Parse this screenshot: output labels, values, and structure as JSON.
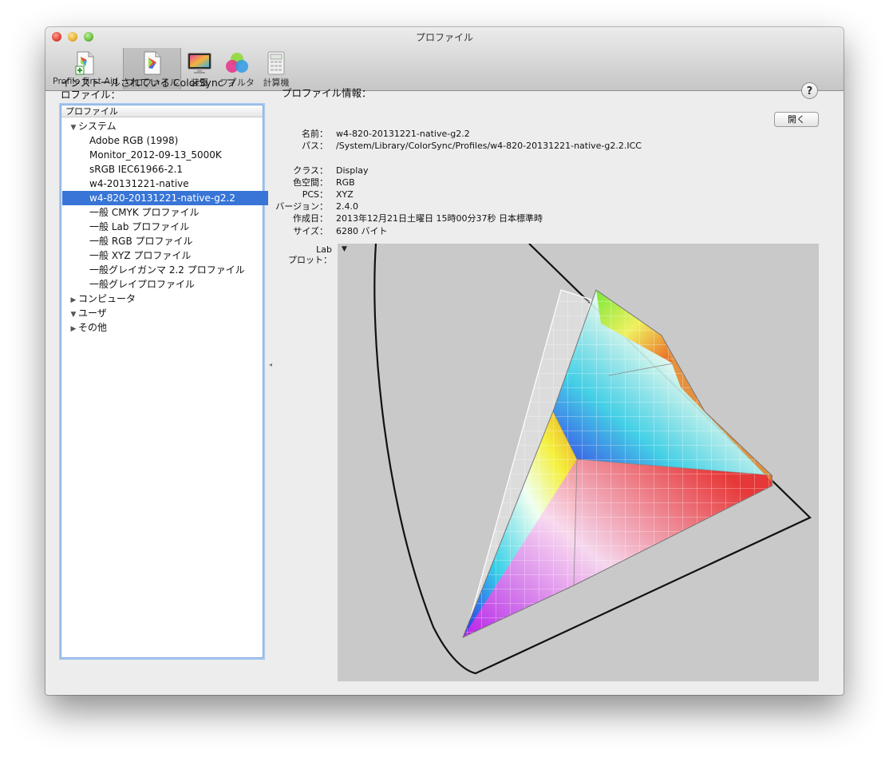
{
  "window": {
    "title": "プロファイル"
  },
  "toolbar": {
    "items": [
      {
        "label": "Profile First Aid",
        "icon": "profile-first-aid-icon"
      },
      {
        "label": "プロファイル",
        "icon": "profile-icon"
      },
      {
        "label": "装置",
        "icon": "display-icon"
      },
      {
        "label": "フィルタ",
        "icon": "filter-icon"
      },
      {
        "label": "計算機",
        "icon": "calculator-icon"
      }
    ]
  },
  "sidebar": {
    "heading": "インストールされている ColorSync プロファイル：",
    "column_header": "プロファイル",
    "tree": [
      {
        "label": "システム",
        "expanded": true,
        "level": 0
      },
      {
        "label": "Adobe RGB (1998)",
        "level": 1
      },
      {
        "label": "Monitor_2012-09-13_5000K",
        "level": 1
      },
      {
        "label": "sRGB IEC61966-2.1",
        "level": 1
      },
      {
        "label": "w4-20131221-native",
        "level": 1
      },
      {
        "label": "w4-820-20131221-native-g2.2",
        "level": 1,
        "selected": true
      },
      {
        "label": "一般 CMYK プロファイル",
        "level": 1
      },
      {
        "label": "一般 Lab プロファイル",
        "level": 1
      },
      {
        "label": "一般 RGB プロファイル",
        "level": 1
      },
      {
        "label": "一般 XYZ プロファイル",
        "level": 1
      },
      {
        "label": "一般グレイガンマ 2.2 プロファイル",
        "level": 1
      },
      {
        "label": "一般グレイプロファイル",
        "level": 1
      },
      {
        "label": "コンピュータ",
        "expanded": false,
        "level": 0
      },
      {
        "label": "ユーザ",
        "expanded": true,
        "level": 0
      },
      {
        "label": "その他",
        "expanded": false,
        "level": 0
      }
    ]
  },
  "info": {
    "heading": "プロファイル情報：",
    "help_label": "?",
    "open_button": "開く",
    "name_label": "名前：",
    "name_value": "w4-820-20131221-native-g2.2",
    "path_label": "パス：",
    "path_value": "/System/Library/ColorSync/Profiles/w4-820-20131221-native-g2.2.ICC",
    "class_label": "クラス：",
    "class_value": "Display",
    "colorspace_label": "色空間：",
    "colorspace_value": "RGB",
    "pcs_label": "PCS：",
    "pcs_value": "XYZ",
    "version_label": "バージョン：",
    "version_value": "2.4.0",
    "created_label": "作成日：",
    "created_value": "2013年12月21日土曜日 15時00分37秒 日本標準時",
    "size_label": "サイズ：",
    "size_value": "6280 バイト",
    "plot_label": "Lab\nプロット："
  },
  "colors": {
    "selection": "#3875d7",
    "plot_background": "#c9c9c9",
    "list_focus_ring": "#a9c8f0"
  }
}
